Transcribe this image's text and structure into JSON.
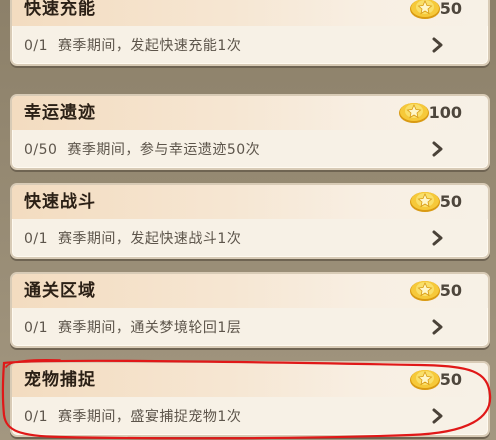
{
  "tasks": [
    {
      "title": "快速充能",
      "progress": "0/1",
      "description": "赛季期间，发起快速充能1次",
      "reward": "50",
      "reward_icon": "gold-coin-icon"
    },
    {
      "title": "幸运遗迹",
      "progress": "0/50",
      "description": "赛季期间，参与幸运遗迹50次",
      "reward": "100",
      "reward_icon": "gold-coin-icon"
    },
    {
      "title": "快速战斗",
      "progress": "0/1",
      "description": "赛季期间，发起快速战斗1次",
      "reward": "50",
      "reward_icon": "gold-coin-icon"
    },
    {
      "title": "通关区域",
      "progress": "0/1",
      "description": "赛季期间，通关梦境轮回1层",
      "reward": "50",
      "reward_icon": "gold-coin-icon"
    },
    {
      "title": "宠物捕捉",
      "progress": "0/1",
      "description": "赛季期间，盛宴捕捉宠物1次",
      "reward": "50",
      "reward_icon": "gold-coin-icon"
    }
  ],
  "colors": {
    "title": "#2b2016",
    "description": "#5d554b",
    "reward": "#4e463c",
    "highlight": "#e01818"
  }
}
